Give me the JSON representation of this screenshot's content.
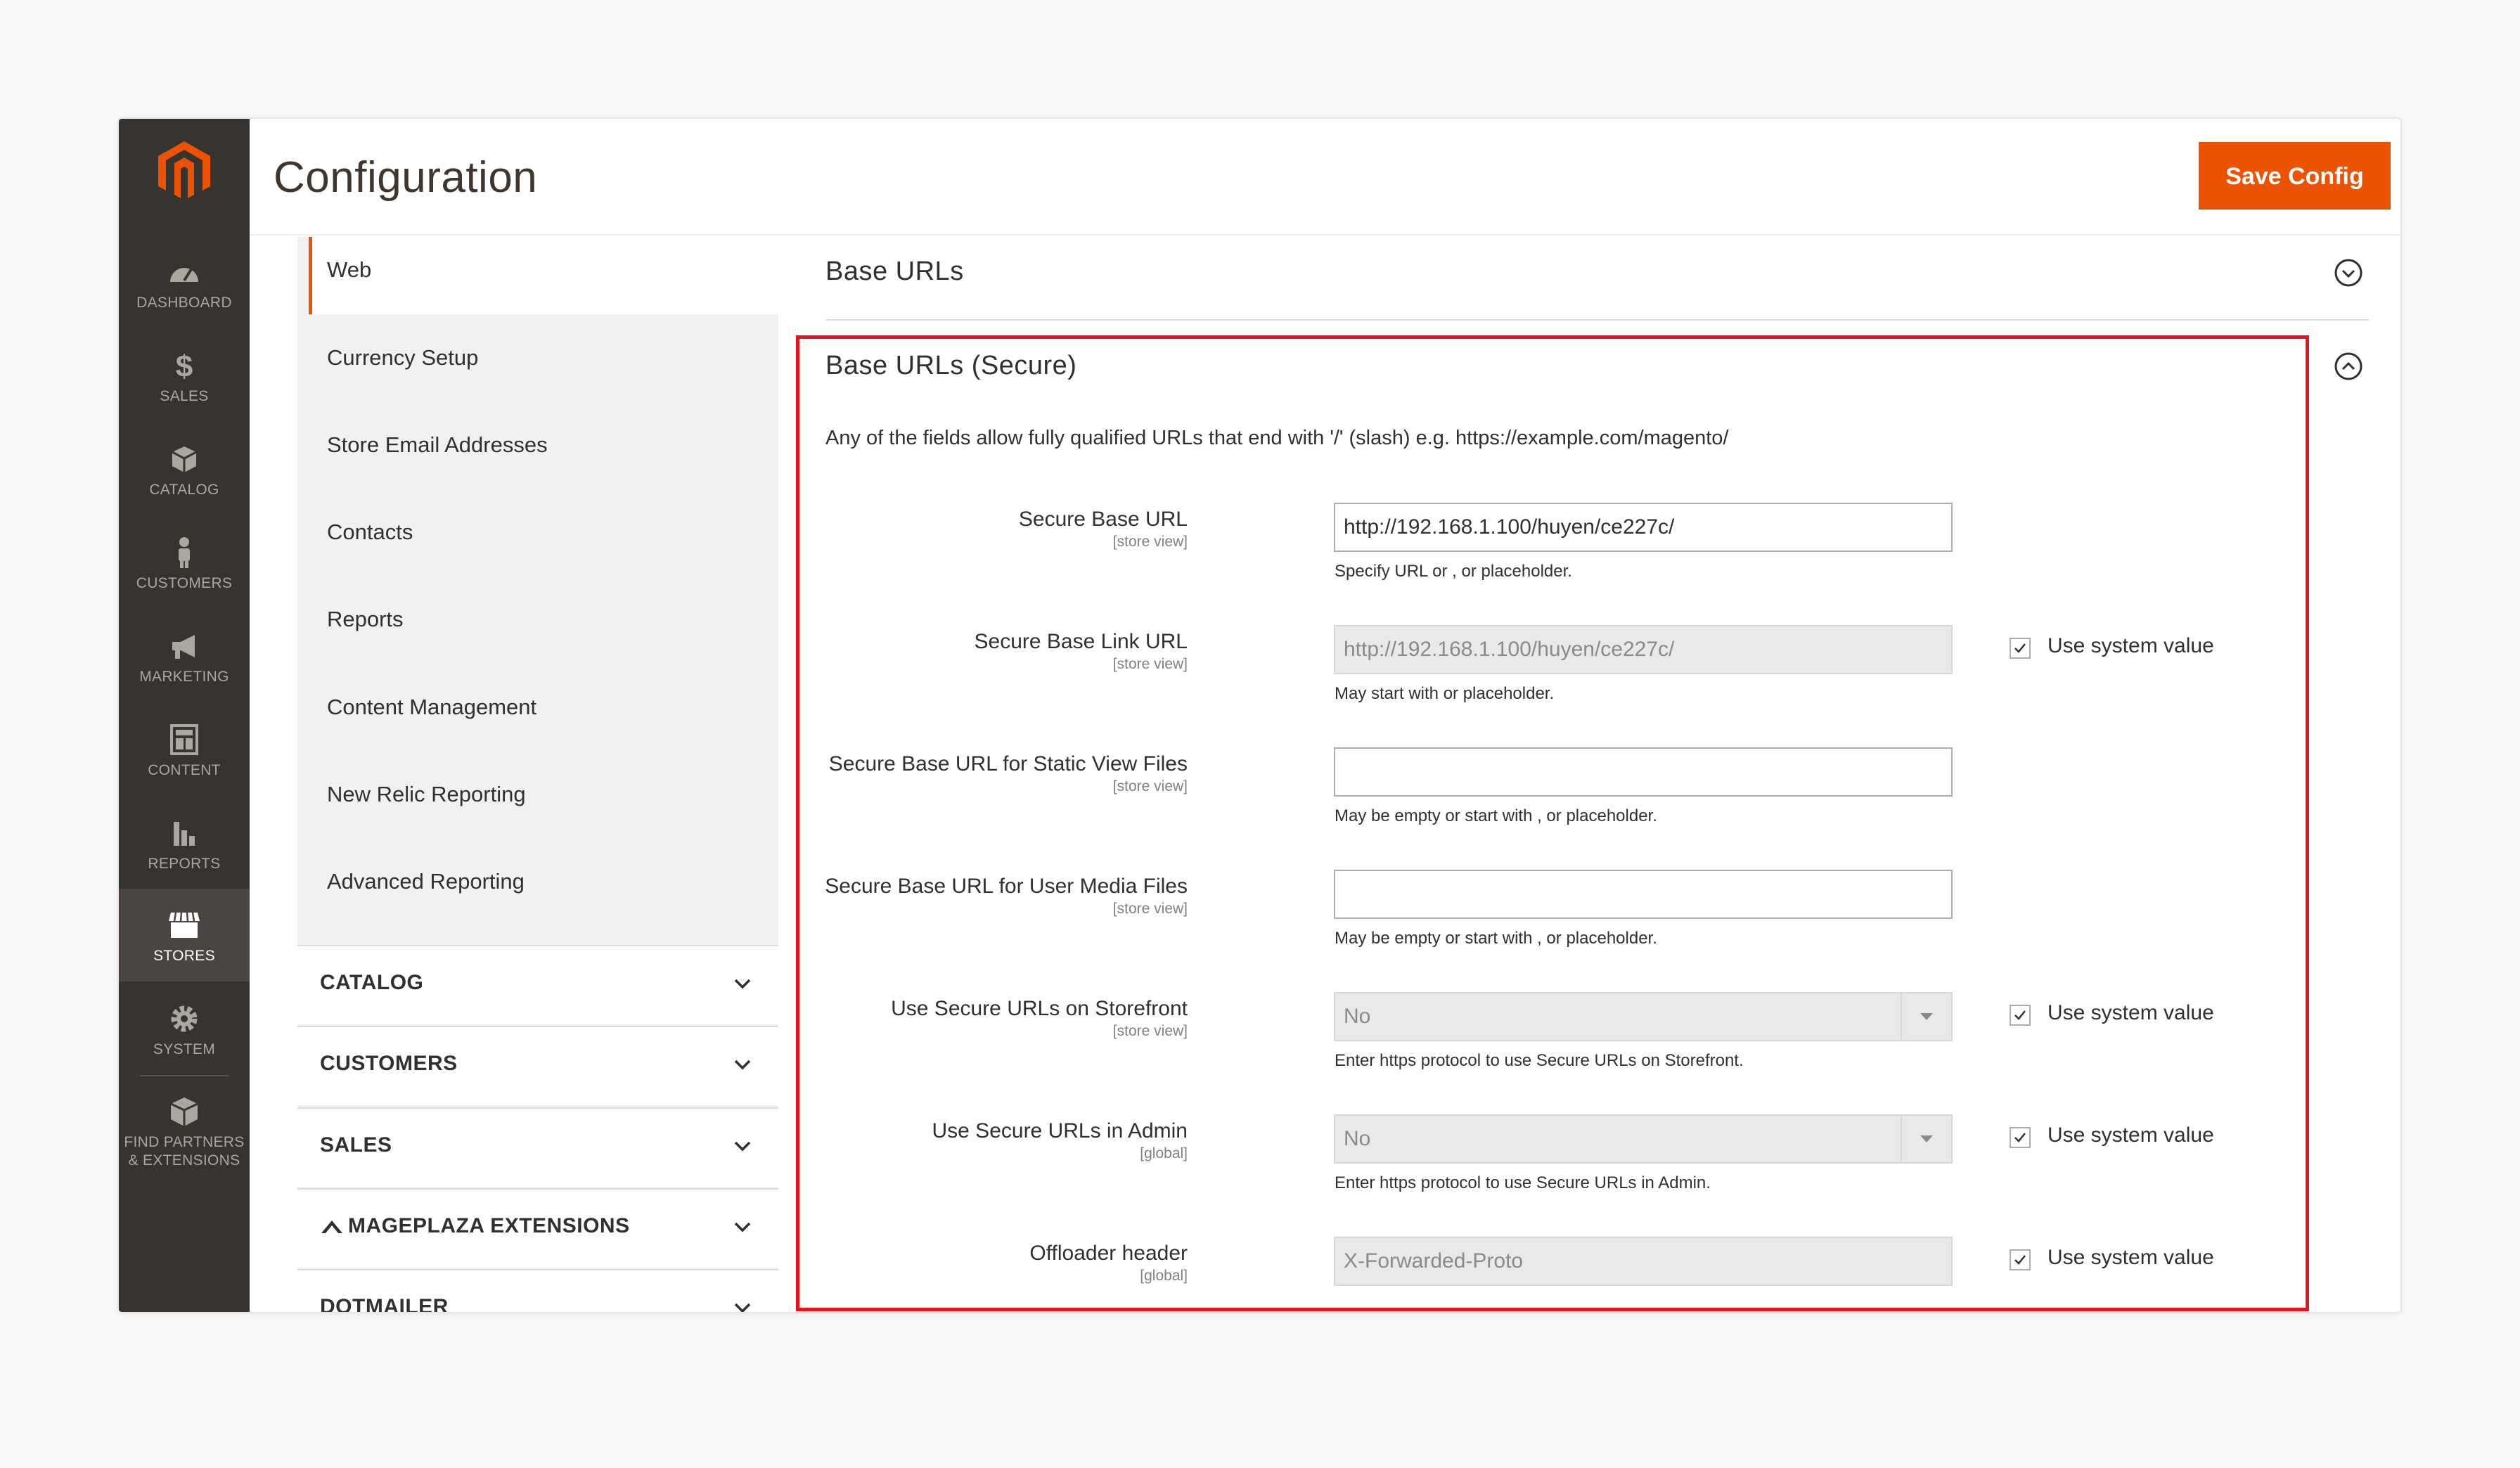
{
  "app": {
    "logo": "magento-logo-icon",
    "accent_color": "#eb5202",
    "highlight_color": "#e3141b"
  },
  "admin_nav": [
    {
      "label": "DASHBOARD",
      "icon": "dashboard-icon"
    },
    {
      "label": "SALES",
      "icon": "dollar-icon"
    },
    {
      "label": "CATALOG",
      "icon": "box-icon"
    },
    {
      "label": "CUSTOMERS",
      "icon": "person-icon"
    },
    {
      "label": "MARKETING",
      "icon": "megaphone-icon"
    },
    {
      "label": "CONTENT",
      "icon": "layout-icon"
    },
    {
      "label": "REPORTS",
      "icon": "bar-chart-icon"
    },
    {
      "label": "STORES",
      "icon": "store-icon",
      "active": true
    },
    {
      "label": "SYSTEM",
      "icon": "gear-icon"
    },
    {
      "label": "FIND PARTNERS",
      "label2": "& EXTENSIONS",
      "icon": "cube-icon"
    }
  ],
  "header": {
    "title": "Configuration",
    "save_label": "Save Config"
  },
  "config_tabs": {
    "active": "Web",
    "items": [
      "Currency Setup",
      "Store Email Addresses",
      "Contacts",
      "Reports",
      "Content Management",
      "New Relic Reporting",
      "Advanced Reporting"
    ],
    "groups": [
      "CATALOG",
      "CUSTOMERS",
      "SALES",
      "MAGEPLAZA EXTENSIONS",
      "DOTMAILER"
    ]
  },
  "sections": {
    "base_urls": "Base URLs",
    "base_urls_secure": "Base URLs (Secure)",
    "intro": "Any of the fields allow fully qualified URLs that end with '/' (slash) e.g. https://example.com/magento/"
  },
  "fields": [
    {
      "label": "Secure Base URL",
      "scope": "[store view]",
      "value": "http://192.168.1.100/huyen/ce227c/",
      "note": "Specify URL or , or placeholder."
    },
    {
      "label": "Secure Base Link URL",
      "scope": "[store view]",
      "value": "http://192.168.1.100/huyen/ce227c/",
      "note": "May start with or placeholder.",
      "system": "Use system value"
    },
    {
      "label": "Secure Base URL for Static View Files",
      "scope": "[store view]",
      "value": "",
      "note": "May be empty or start with , or placeholder."
    },
    {
      "label": "Secure Base URL for User Media Files",
      "scope": "[store view]",
      "value": "",
      "note": "May be empty or start with , or placeholder."
    },
    {
      "label": "Use Secure URLs on Storefront",
      "scope": "[store view]",
      "value": "No",
      "note": "Enter https protocol to use Secure URLs on Storefront.",
      "system": "Use system value"
    },
    {
      "label": "Use Secure URLs in Admin",
      "scope": "[global]",
      "value": "No",
      "note": "Enter https protocol to use Secure URLs in Admin.",
      "system": "Use system value"
    },
    {
      "label": "Offloader header",
      "scope": "[global]",
      "value": "X-Forwarded-Proto",
      "system": "Use system value"
    }
  ]
}
